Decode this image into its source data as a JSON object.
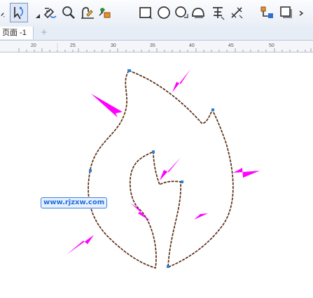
{
  "toolbar": {
    "tools": [
      {
        "name": "pick-tool-icon",
        "selected": false
      },
      {
        "name": "shape-tool-icon",
        "selected": true
      },
      {
        "name": "smear-tool-icon",
        "selected": false
      },
      {
        "name": "zoom-tool-icon",
        "selected": false
      },
      {
        "name": "freehand-tool-icon",
        "selected": false
      },
      {
        "name": "smart-fill-tool-icon",
        "selected": false
      },
      {
        "name": "rectangle-tool-icon",
        "selected": false
      },
      {
        "name": "ellipse-tool-icon",
        "selected": false
      },
      {
        "name": "polygon-tool-icon",
        "selected": false
      },
      {
        "name": "basic-shapes-tool-icon",
        "selected": false
      },
      {
        "name": "text-tool-icon",
        "selected": false
      },
      {
        "name": "dimension-tool-icon",
        "selected": false
      },
      {
        "name": "connector-tool-icon",
        "selected": false
      },
      {
        "name": "drop-shadow-tool-icon",
        "selected": false
      }
    ]
  },
  "page_tab": {
    "label": "页面 -1"
  },
  "ruler": {
    "labels": [
      "20",
      "25",
      "30",
      "35",
      "40",
      "45",
      "50"
    ]
  },
  "watermark": {
    "text": "www.rjzxw.com"
  },
  "colors": {
    "arrow": "#ff00ff",
    "outline": "#5a2e14",
    "node": "#2a7fd4"
  }
}
